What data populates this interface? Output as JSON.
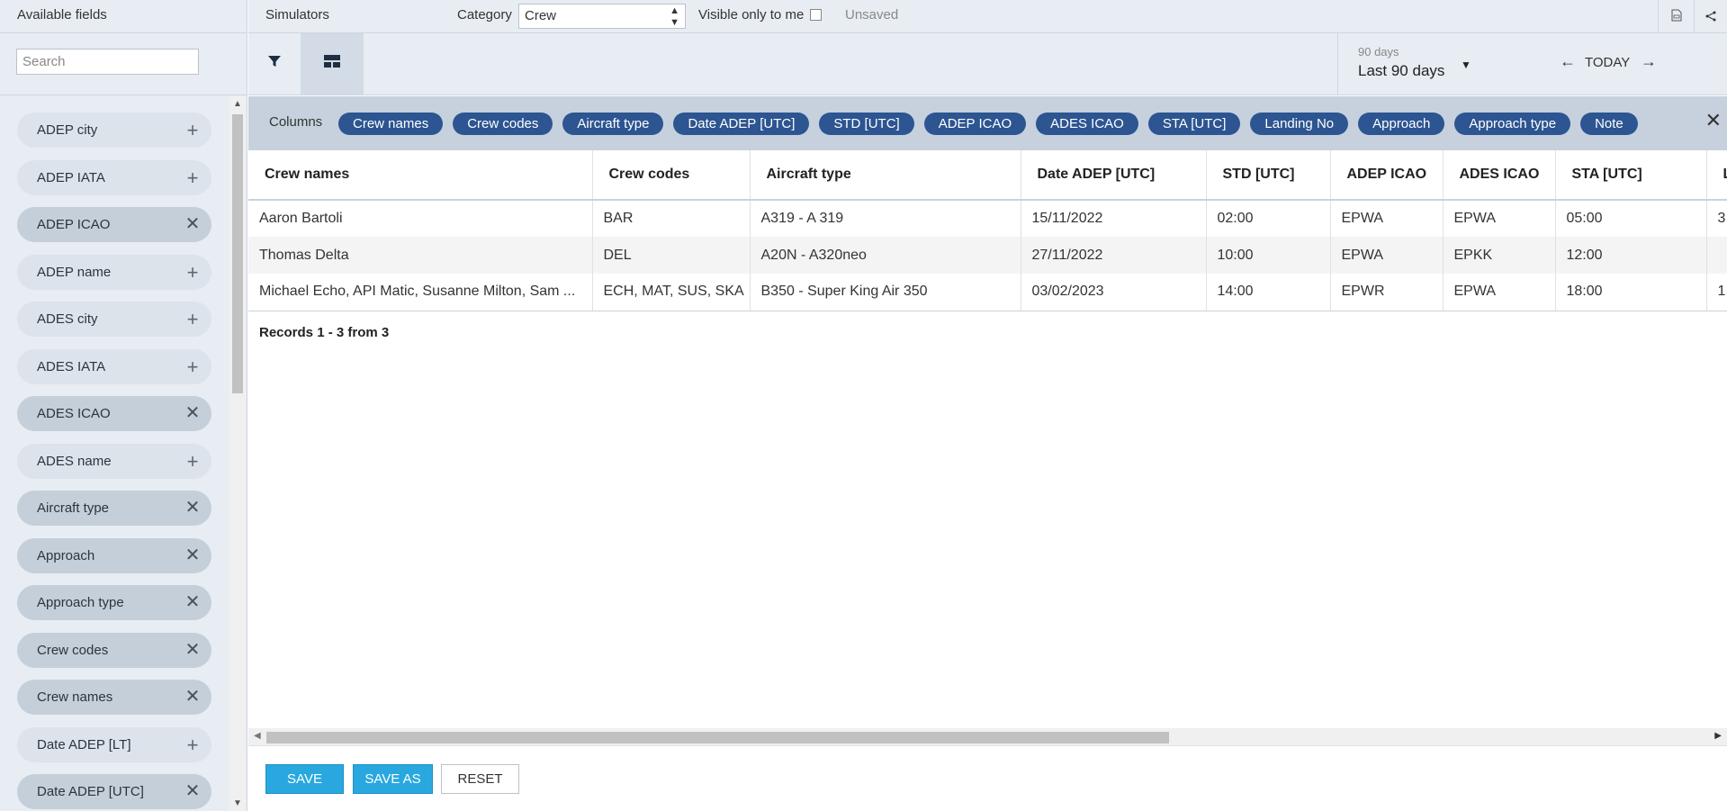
{
  "left_panel": {
    "title": "Available fields",
    "search_placeholder": "Search",
    "fields": [
      {
        "label": "ADEP city",
        "selected": false,
        "action": "+"
      },
      {
        "label": "ADEP IATA",
        "selected": false,
        "action": "+"
      },
      {
        "label": "ADEP ICAO",
        "selected": true,
        "action": "✕"
      },
      {
        "label": "ADEP name",
        "selected": false,
        "action": "+"
      },
      {
        "label": "ADES city",
        "selected": false,
        "action": "+"
      },
      {
        "label": "ADES IATA",
        "selected": false,
        "action": "+"
      },
      {
        "label": "ADES ICAO",
        "selected": true,
        "action": "✕"
      },
      {
        "label": "ADES name",
        "selected": false,
        "action": "+"
      },
      {
        "label": "Aircraft type",
        "selected": true,
        "action": "✕"
      },
      {
        "label": "Approach",
        "selected": true,
        "action": "✕"
      },
      {
        "label": "Approach type",
        "selected": true,
        "action": "✕"
      },
      {
        "label": "Crew codes",
        "selected": true,
        "action": "✕"
      },
      {
        "label": "Crew names",
        "selected": true,
        "action": "✕"
      },
      {
        "label": "Date ADEP [LT]",
        "selected": false,
        "action": "+"
      },
      {
        "label": "Date ADEP [UTC]",
        "selected": true,
        "action": "✕"
      }
    ]
  },
  "topbar": {
    "simulators": "Simulators",
    "category_label": "Category",
    "category_value": "Crew",
    "visible_label": "Visible only to me",
    "unsaved": "Unsaved",
    "export_icon": "▯",
    "share_icon": "<"
  },
  "toolbar": {
    "filter_icon": "filter-icon",
    "layout_icon": "layout-icon"
  },
  "period": {
    "small": "90 days",
    "main": "Last 90 days",
    "caret": "▼",
    "prev": "←",
    "today": "TODAY",
    "next": "→"
  },
  "columns_bar": {
    "label": "Columns",
    "chips": [
      "Crew names",
      "Crew codes",
      "Aircraft type",
      "Date ADEP [UTC]",
      "STD [UTC]",
      "ADEP ICAO",
      "ADES ICAO",
      "STA [UTC]",
      "Landing No",
      "Approach",
      "Approach type",
      "Note"
    ],
    "close": "✕"
  },
  "grid": {
    "headers": [
      "Crew names",
      "Crew codes",
      "Aircraft type",
      "Date ADEP [UTC]",
      "STD [UTC]",
      "ADEP ICAO",
      "ADES ICAO",
      "STA [UTC]",
      "L"
    ],
    "rows": [
      [
        "Aaron Bartoli",
        "BAR",
        "A319 - A 319",
        "15/11/2022",
        "02:00",
        "EPWA",
        "EPWA",
        "05:00",
        "3"
      ],
      [
        "Thomas Delta",
        "DEL",
        "A20N - A320neo",
        "27/11/2022",
        "10:00",
        "EPWA",
        "EPKK",
        "12:00",
        ""
      ],
      [
        "Michael Echo, API Matic, Susanne Milton, Sam ...",
        "ECH, MAT, SUS, SKA",
        "B350 - Super King Air 350",
        "03/02/2023",
        "14:00",
        "EPWR",
        "EPWA",
        "18:00",
        "1"
      ]
    ],
    "records": "Records 1 - 3 from 3"
  },
  "footer": {
    "save": "SAVE",
    "save_as": "SAVE AS",
    "reset": "RESET"
  },
  "colors": {
    "chip_blue": "#2c5591",
    "button_blue": "#29a8e0",
    "panel_bg": "#e8edf3",
    "column_bar_bg": "#c6d1dd"
  }
}
